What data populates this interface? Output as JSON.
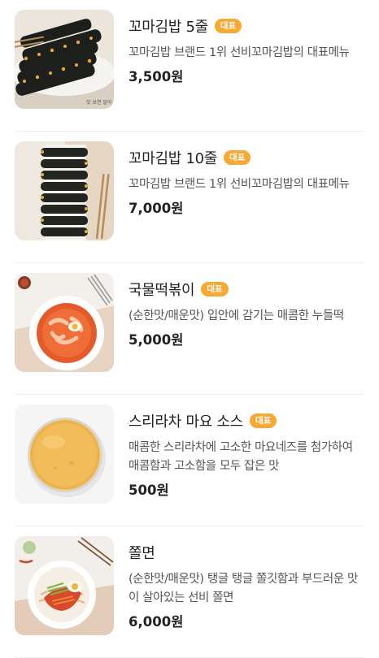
{
  "menu": [
    {
      "name": "꼬마김밥 5줄",
      "badge": "대표",
      "desc": "꼬마김밥 브랜드 1위 선비꼬마김밥의 대표메뉴",
      "price": "3,500원",
      "image": "gimbap-5-image"
    },
    {
      "name": "꼬마김밥 10줄",
      "badge": "대표",
      "desc": "꼬마김밥 브랜드 1위 선비꼬마김밥의 대표메뉴",
      "price": "7,000원",
      "image": "gimbap-10-image"
    },
    {
      "name": "국물떡볶이",
      "badge": "대표",
      "desc": "(순한맛/매운맛) 입안에 감기는 매콤한 누들떡",
      "price": "5,000원",
      "image": "tteokbokki-image"
    },
    {
      "name": "스리라차 마요 소스",
      "badge": "대표",
      "desc": "매콤한 스리라차에 고소한 마요네즈를 첨가하여 매콤함과 고소함을 모두 잡은 맛",
      "price": "500원",
      "image": "sriracha-mayo-image"
    },
    {
      "name": "쫄면",
      "badge": "",
      "desc": "(순한맛/매운맛) 탱글 탱글 쫄깃함과 부드러운 맛이 살아있는 선비 쫄면",
      "price": "6,000원",
      "image": "jjolmyeon-image"
    }
  ],
  "colors": {
    "badge": "#f7a934",
    "divider": "#efefef"
  }
}
